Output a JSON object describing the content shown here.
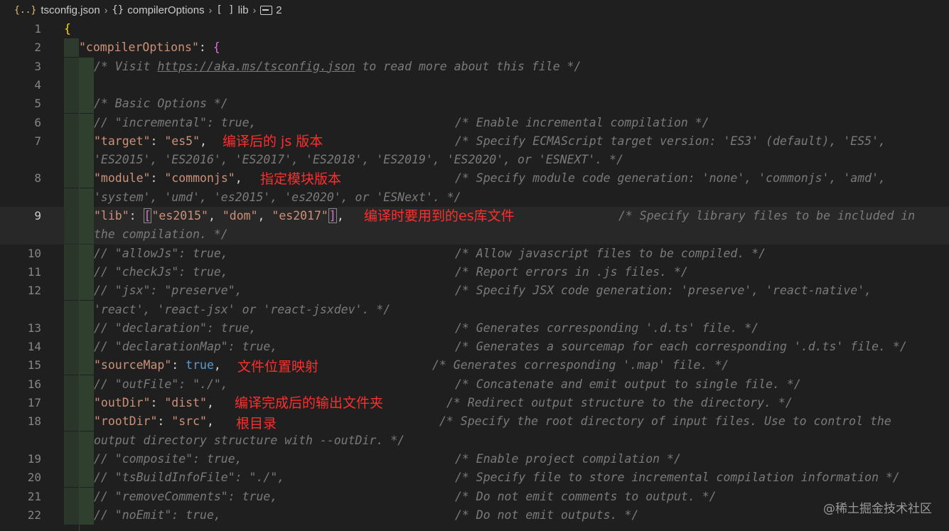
{
  "breadcrumb": {
    "file": "tsconfig.json",
    "items": [
      "compilerOptions",
      "lib",
      "2"
    ]
  },
  "lines": [
    {
      "n": "1",
      "code": "{"
    },
    {
      "n": "2",
      "prop": "\"compilerOptions\"",
      "rest": ": {"
    },
    {
      "n": "3",
      "comment_pre": "/* Visit ",
      "url": "https://aka.ms/tsconfig.json",
      "comment_post": " to read more about this file */"
    },
    {
      "n": "4",
      "code": ""
    },
    {
      "n": "5",
      "comment": "/* Basic Options */"
    },
    {
      "n": "6",
      "code": "// \"incremental\": true,",
      "tail": "/* Enable incremental compilation */"
    },
    {
      "n": "7",
      "prop": "\"target\"",
      "value": "\"es5\"",
      "tail": "/* Specify ECMAScript target version: 'ES3' (default), 'ES5',",
      "cont": "'ES2015', 'ES2016', 'ES2017', 'ES2018', 'ES2019', 'ES2020', or 'ESNEXT'. */"
    },
    {
      "n": "8",
      "prop": "\"module\"",
      "value": "\"commonjs\"",
      "tail": "/* Specify module code generation: 'none', 'commonjs', 'amd',",
      "cont": "'system', 'umd', 'es2015', 'es2020', or 'ESNext'. */"
    },
    {
      "n": "9",
      "prop": "\"lib\"",
      "values": [
        "\"es2015\"",
        "\"dom\"",
        "\"es2017\""
      ],
      "tail": "/* Specify library files to be included in",
      "cont": "the compilation. */"
    },
    {
      "n": "10",
      "code": "// \"allowJs\": true,",
      "tail": "/* Allow javascript files to be compiled. */"
    },
    {
      "n": "11",
      "code": "// \"checkJs\": true,",
      "tail": "/* Report errors in .js files. */"
    },
    {
      "n": "12",
      "code": "// \"jsx\": \"preserve\",",
      "tail": "/* Specify JSX code generation: 'preserve', 'react-native',",
      "cont": "'react', 'react-jsx' or 'react-jsxdev'. */"
    },
    {
      "n": "13",
      "code": "// \"declaration\": true,",
      "tail": "/* Generates corresponding '.d.ts' file. */"
    },
    {
      "n": "14",
      "code": "// \"declarationMap\": true,",
      "tail": "/* Generates a sourcemap for each corresponding '.d.ts' file. */"
    },
    {
      "n": "15",
      "prop": "\"sourceMap\"",
      "bool": "true",
      "tail": "/* Generates corresponding '.map' file. */"
    },
    {
      "n": "16",
      "code": "// \"outFile\": \"./\",",
      "tail": "/* Concatenate and emit output to single file. */"
    },
    {
      "n": "17",
      "prop": "\"outDir\"",
      "value": "\"dist\"",
      "tail": "/* Redirect output structure to the directory. */"
    },
    {
      "n": "18",
      "prop": "\"rootDir\"",
      "value": "\"src\"",
      "tail": "/* Specify the root directory of input files. Use to control the",
      "cont": "output directory structure with --outDir. */"
    },
    {
      "n": "19",
      "code": "// \"composite\": true,",
      "tail": "/* Enable project compilation */"
    },
    {
      "n": "20",
      "code": "// \"tsBuildInfoFile\": \"./\",",
      "tail": "/* Specify file to store incremental compilation information */"
    },
    {
      "n": "21",
      "code": "// \"removeComments\": true,",
      "tail": "/* Do not emit comments to output. */"
    },
    {
      "n": "22",
      "code": "// \"noEmit\": true,",
      "tail": "/* Do not emit outputs. */"
    }
  ],
  "annotations": {
    "target": "编译后的 js 版本",
    "module": "指定模块版本",
    "lib": "编译时要用到的es库文件",
    "sourceMap": "文件位置映射",
    "outDir": "编译完成后的输出文件夹",
    "rootDir": "根目录"
  },
  "watermark": "@稀土掘金技术社区"
}
